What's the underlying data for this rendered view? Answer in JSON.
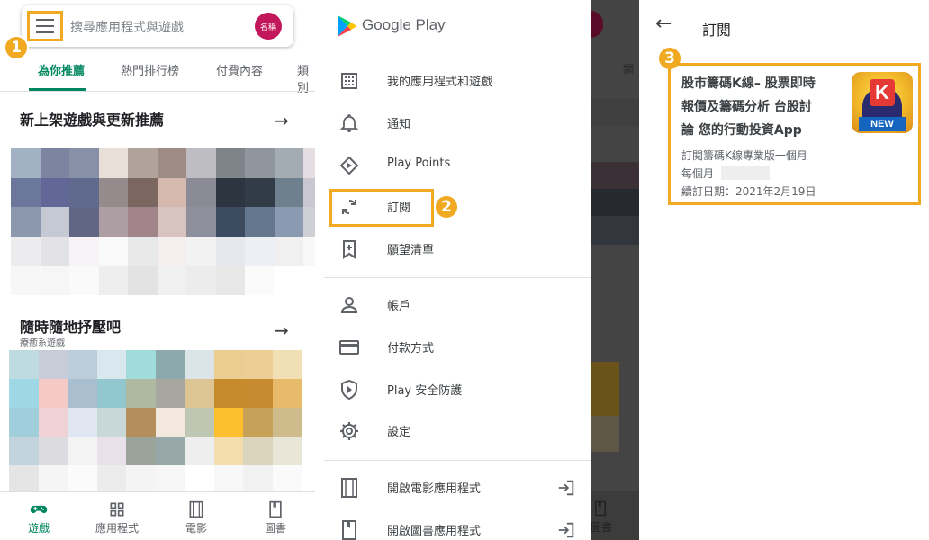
{
  "panel1": {
    "search_placeholder": "搜尋應用程式與遊戲",
    "avatar_text": "名稱",
    "tabs": [
      "為你推薦",
      "熱門排行榜",
      "付費內容",
      "類別"
    ],
    "section1_title": "新上架遊戲與更新推薦",
    "section2_title": "隨時隨地抒壓吧",
    "section2_subtitle": "療癒系遊戲",
    "bottom_nav": [
      "遊戲",
      "應用程式",
      "電影",
      "圖書"
    ],
    "callout": "1"
  },
  "drawer": {
    "brand": "Google Play",
    "items": [
      "我的應用程式和遊戲",
      "通知",
      "Play Points",
      "訂閱",
      "願望清單",
      "帳戶",
      "付款方式",
      "Play 安全防護",
      "設定",
      "開啟電影應用程式",
      "開啟圖書應用程式"
    ],
    "callout": "2"
  },
  "panel3": {
    "title": "訂閱",
    "app_title": "股市籌碼K線– 股票即時報價及籌碼分析 台股討論 您的行動投資App",
    "app_title_lines": [
      "股市籌碼K線– 股票即時",
      "報價及籌碼分析 台股討",
      "論 您的行動投資App"
    ],
    "plan": "訂閱籌碼K線專業版一個月",
    "billing": "每個月",
    "renewal": "續訂日期：2021年2月19日",
    "icon_letter": "K",
    "icon_badge": "NEW",
    "callout": "3"
  },
  "colors": {
    "accent_green": "#01875f",
    "callout_orange": "#f2a922",
    "avatar_bg": "#c2185b"
  }
}
